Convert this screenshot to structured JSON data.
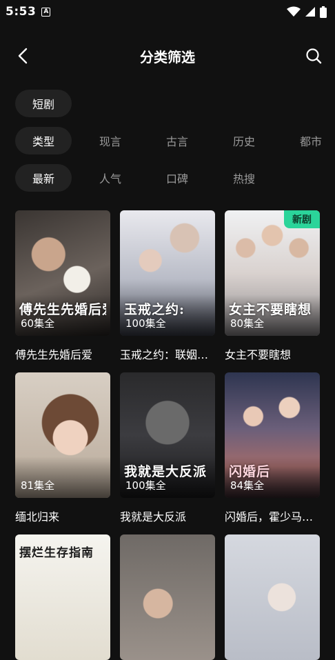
{
  "status": {
    "time": "5:53",
    "app_badge": "A"
  },
  "header": {
    "title": "分类筛选"
  },
  "filters": {
    "row1": [
      {
        "label": "短剧",
        "active": true
      }
    ],
    "row2": [
      {
        "label": "类型",
        "active": true
      },
      {
        "label": "现言",
        "active": false
      },
      {
        "label": "古言",
        "active": false
      },
      {
        "label": "历史",
        "active": false
      },
      {
        "label": "都市",
        "active": false
      }
    ],
    "row3": [
      {
        "label": "最新",
        "active": true
      },
      {
        "label": "人气",
        "active": false
      },
      {
        "label": "口碑",
        "active": false
      },
      {
        "label": "热搜",
        "active": false
      }
    ]
  },
  "dramas": [
    {
      "title": "傅先生先婚后爱",
      "count": "60集全",
      "art_text": "傅先生先婚后爱",
      "badge": ""
    },
    {
      "title": "玉戒之约：联姻战里的真心",
      "count": "100集全",
      "art_text": "玉戒之约:",
      "badge": ""
    },
    {
      "title": "女主不要瞎想",
      "count": "80集全",
      "art_text": "女主不要瞎想",
      "badge": "新剧"
    },
    {
      "title": "缅北归来",
      "count": "81集全",
      "art_text": "缅北归来",
      "badge": ""
    },
    {
      "title": "我就是大反派",
      "count": "100集全",
      "art_text": "我就是大反派",
      "badge": ""
    },
    {
      "title": "闪婚后，霍少马甲藏不住了",
      "count": "84集全",
      "art_text": "闪婚后",
      "badge": ""
    },
    {
      "title": "",
      "count": "",
      "art_text": "摆烂生存指南",
      "badge": ""
    },
    {
      "title": "",
      "count": "",
      "art_text": "",
      "badge": ""
    },
    {
      "title": "",
      "count": "",
      "art_text": "",
      "badge": ""
    }
  ],
  "colors": {
    "background": "#111111",
    "chip_active": "#222222",
    "badge_new": "#2bd49a"
  }
}
